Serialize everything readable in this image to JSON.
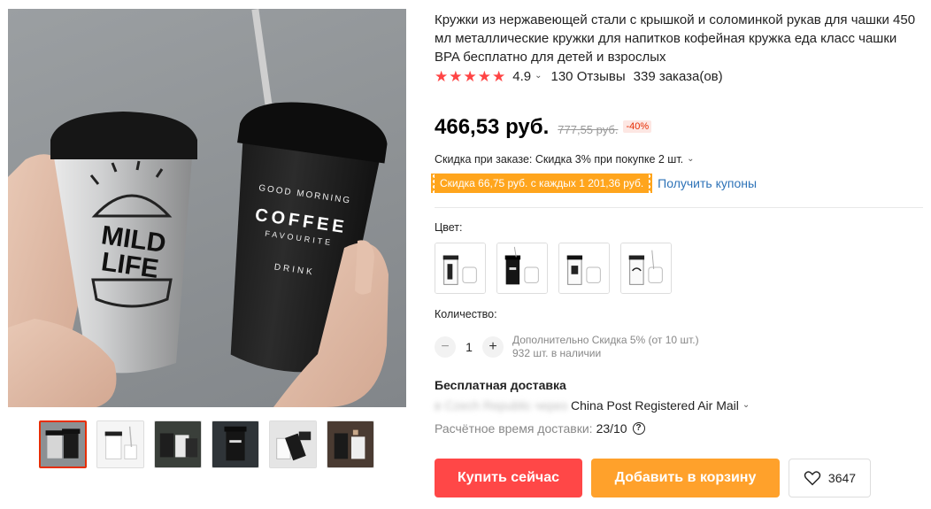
{
  "product": {
    "title": "Кружки из нержавеющей стали с крышкой и соломинкой рукав для чашки 450 мл металлические кружки для напитков кофейная кружка еда класс чашки BPA бесплатно для детей и взрослых",
    "rating": "4.9",
    "reviews": "130 Отзывы",
    "orders": "339 заказа(ов)"
  },
  "pricing": {
    "price": "466,53 руб.",
    "old_price": "777,55 руб.",
    "discount": "-40%",
    "bulk_discount": "Скидка при заказе: Скидка 3% при покупке 2 шт.",
    "coupon_tag": "Скидка 66,75 руб. с каждых 1 201,36 руб.",
    "get_coupons": "Получить купоны"
  },
  "variants": {
    "color_label": "Цвет:",
    "colors": [
      {
        "icon": "white-cup-variant"
      },
      {
        "icon": "black-cup-variant"
      },
      {
        "icon": "black-white-cup-variant"
      },
      {
        "icon": "white-cup-lettering-variant"
      }
    ]
  },
  "quantity": {
    "label": "Количество:",
    "value": "1",
    "minus": "−",
    "plus": "+",
    "extra_discount": "Дополнительно Скидка 5% (от 10 шт.)",
    "stock": "932 шт. в наличии"
  },
  "shipping": {
    "title": "Бесплатная доставка",
    "destination_blurred": "в Czech Republic через",
    "method": "China Post Registered Air Mail",
    "delivery_label": "Расчётное время доставки:",
    "delivery_value": "23/10",
    "help": "?"
  },
  "actions": {
    "buy_now": "Купить сейчас",
    "add_to_cart": "Добавить в корзину",
    "wishlist_count": "3647"
  },
  "gallery": {
    "main_cup_left_text": [
      "MILD",
      "LIFE"
    ],
    "main_cup_right_text": {
      "top": "GOOD MORNING",
      "middle": "COFFEE",
      "sub": "FAVOURITE",
      "bottom": "DRINK"
    },
    "thumbnail_count": 6,
    "active_thumbnail": 1
  },
  "colors": {
    "accent_red": "#ff4747",
    "accent_orange": "#ffa12b",
    "star": "#ff4444",
    "link": "#2e73b8",
    "coupon": "#ffa51d"
  }
}
